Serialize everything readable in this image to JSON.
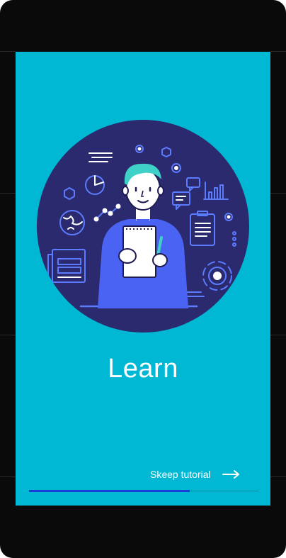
{
  "screen": {
    "title": "Learn",
    "illustration_icon": "learn-illustration-icon",
    "skip_label": "Skeep tutorial",
    "skip_icon": "arrow-right-icon",
    "progress": 0.7
  },
  "colors": {
    "background": "#00b8d4",
    "circle": "#2c2a6e",
    "progress": "#1a3fd8",
    "text": "#ffffff"
  }
}
